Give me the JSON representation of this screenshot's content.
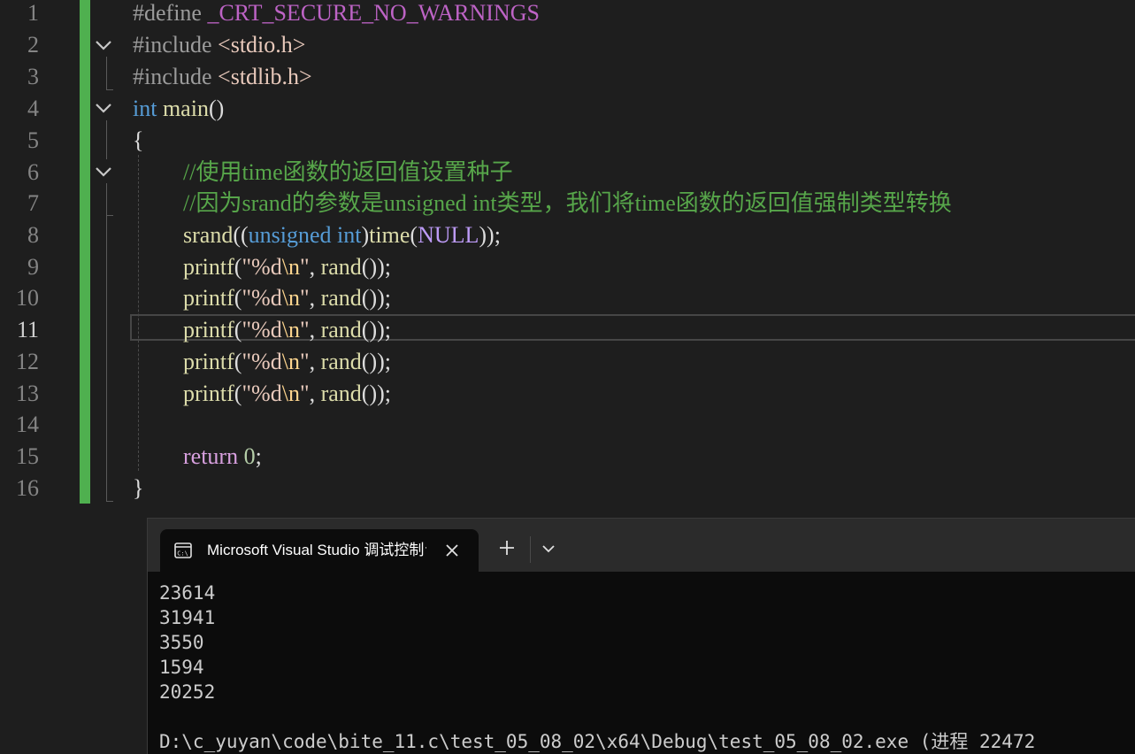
{
  "editor": {
    "line_numbers": [
      "1",
      "2",
      "3",
      "4",
      "5",
      "6",
      "7",
      "8",
      "9",
      "10",
      "11",
      "12",
      "13",
      "14",
      "15",
      "16"
    ],
    "current_line": "11",
    "code": {
      "l1": {
        "directive": "#define",
        "macro": "_CRT_SECURE_NO_WARNINGS"
      },
      "l2": {
        "directive": "#include",
        "header": "<stdio.h>"
      },
      "l3": {
        "directive": "#include",
        "header": "<stdlib.h>"
      },
      "l4": {
        "type": "int",
        "func": "main",
        "parens": "()"
      },
      "l5": {
        "brace": "{"
      },
      "l6": {
        "comment": "//使用time函数的返回值设置种子"
      },
      "l7": {
        "comment": "//因为srand的参数是unsigned int类型，我们将time函数的返回值强制类型转换"
      },
      "l8": {
        "func": "srand",
        "open": "((",
        "kw1": "unsigned",
        "kw2": "int",
        "close1": ")",
        "func2": "time",
        "open2": "(",
        "null": "NULL",
        "close2": "));"
      },
      "printf_lines": [
        {
          "func": "printf",
          "open": "(",
          "str_a": "\"%d",
          "esc": "\\n",
          "str_b": "\"",
          "comma": ", ",
          "func2": "rand",
          "close": "());"
        },
        {
          "func": "printf",
          "open": "(",
          "str_a": "\"%d",
          "esc": "\\n",
          "str_b": "\"",
          "comma": ", ",
          "func2": "rand",
          "close": "());"
        },
        {
          "func": "printf",
          "open": "(",
          "str_a": "\"%d",
          "esc": "\\n",
          "str_b": "\"",
          "comma": ", ",
          "func2": "rand",
          "close": "());"
        },
        {
          "func": "printf",
          "open": "(",
          "str_a": "\"%d",
          "esc": "\\n",
          "str_b": "\"",
          "comma": ", ",
          "func2": "rand",
          "close": "());"
        },
        {
          "func": "printf",
          "open": "(",
          "str_a": "\"%d",
          "esc": "\\n",
          "str_b": "\"",
          "comma": ", ",
          "func2": "rand",
          "close": "());"
        }
      ],
      "l15": {
        "kw": "return",
        "num": "0",
        "semi": ";"
      },
      "l16": {
        "brace": "}"
      }
    }
  },
  "terminal": {
    "tab_icon": "console-icon",
    "tab_title": "Microsoft Visual Studio 调试控制台",
    "new_tab_label": "+",
    "output_lines": [
      "23614",
      "31941",
      "3550",
      "1594",
      "20252"
    ],
    "exit_line": "D:\\c_yuyan\\code\\bite_11.c\\test_05_08_02\\x64\\Debug\\test_05_08_02.exe (进程 22472"
  },
  "colors": {
    "change_bar": "#4fb04f",
    "comment": "#57a64a",
    "keyword": "#569cd6",
    "function": "#dcdcaa",
    "string": "#e8c9bb",
    "control_keyword": "#d8a0df"
  }
}
